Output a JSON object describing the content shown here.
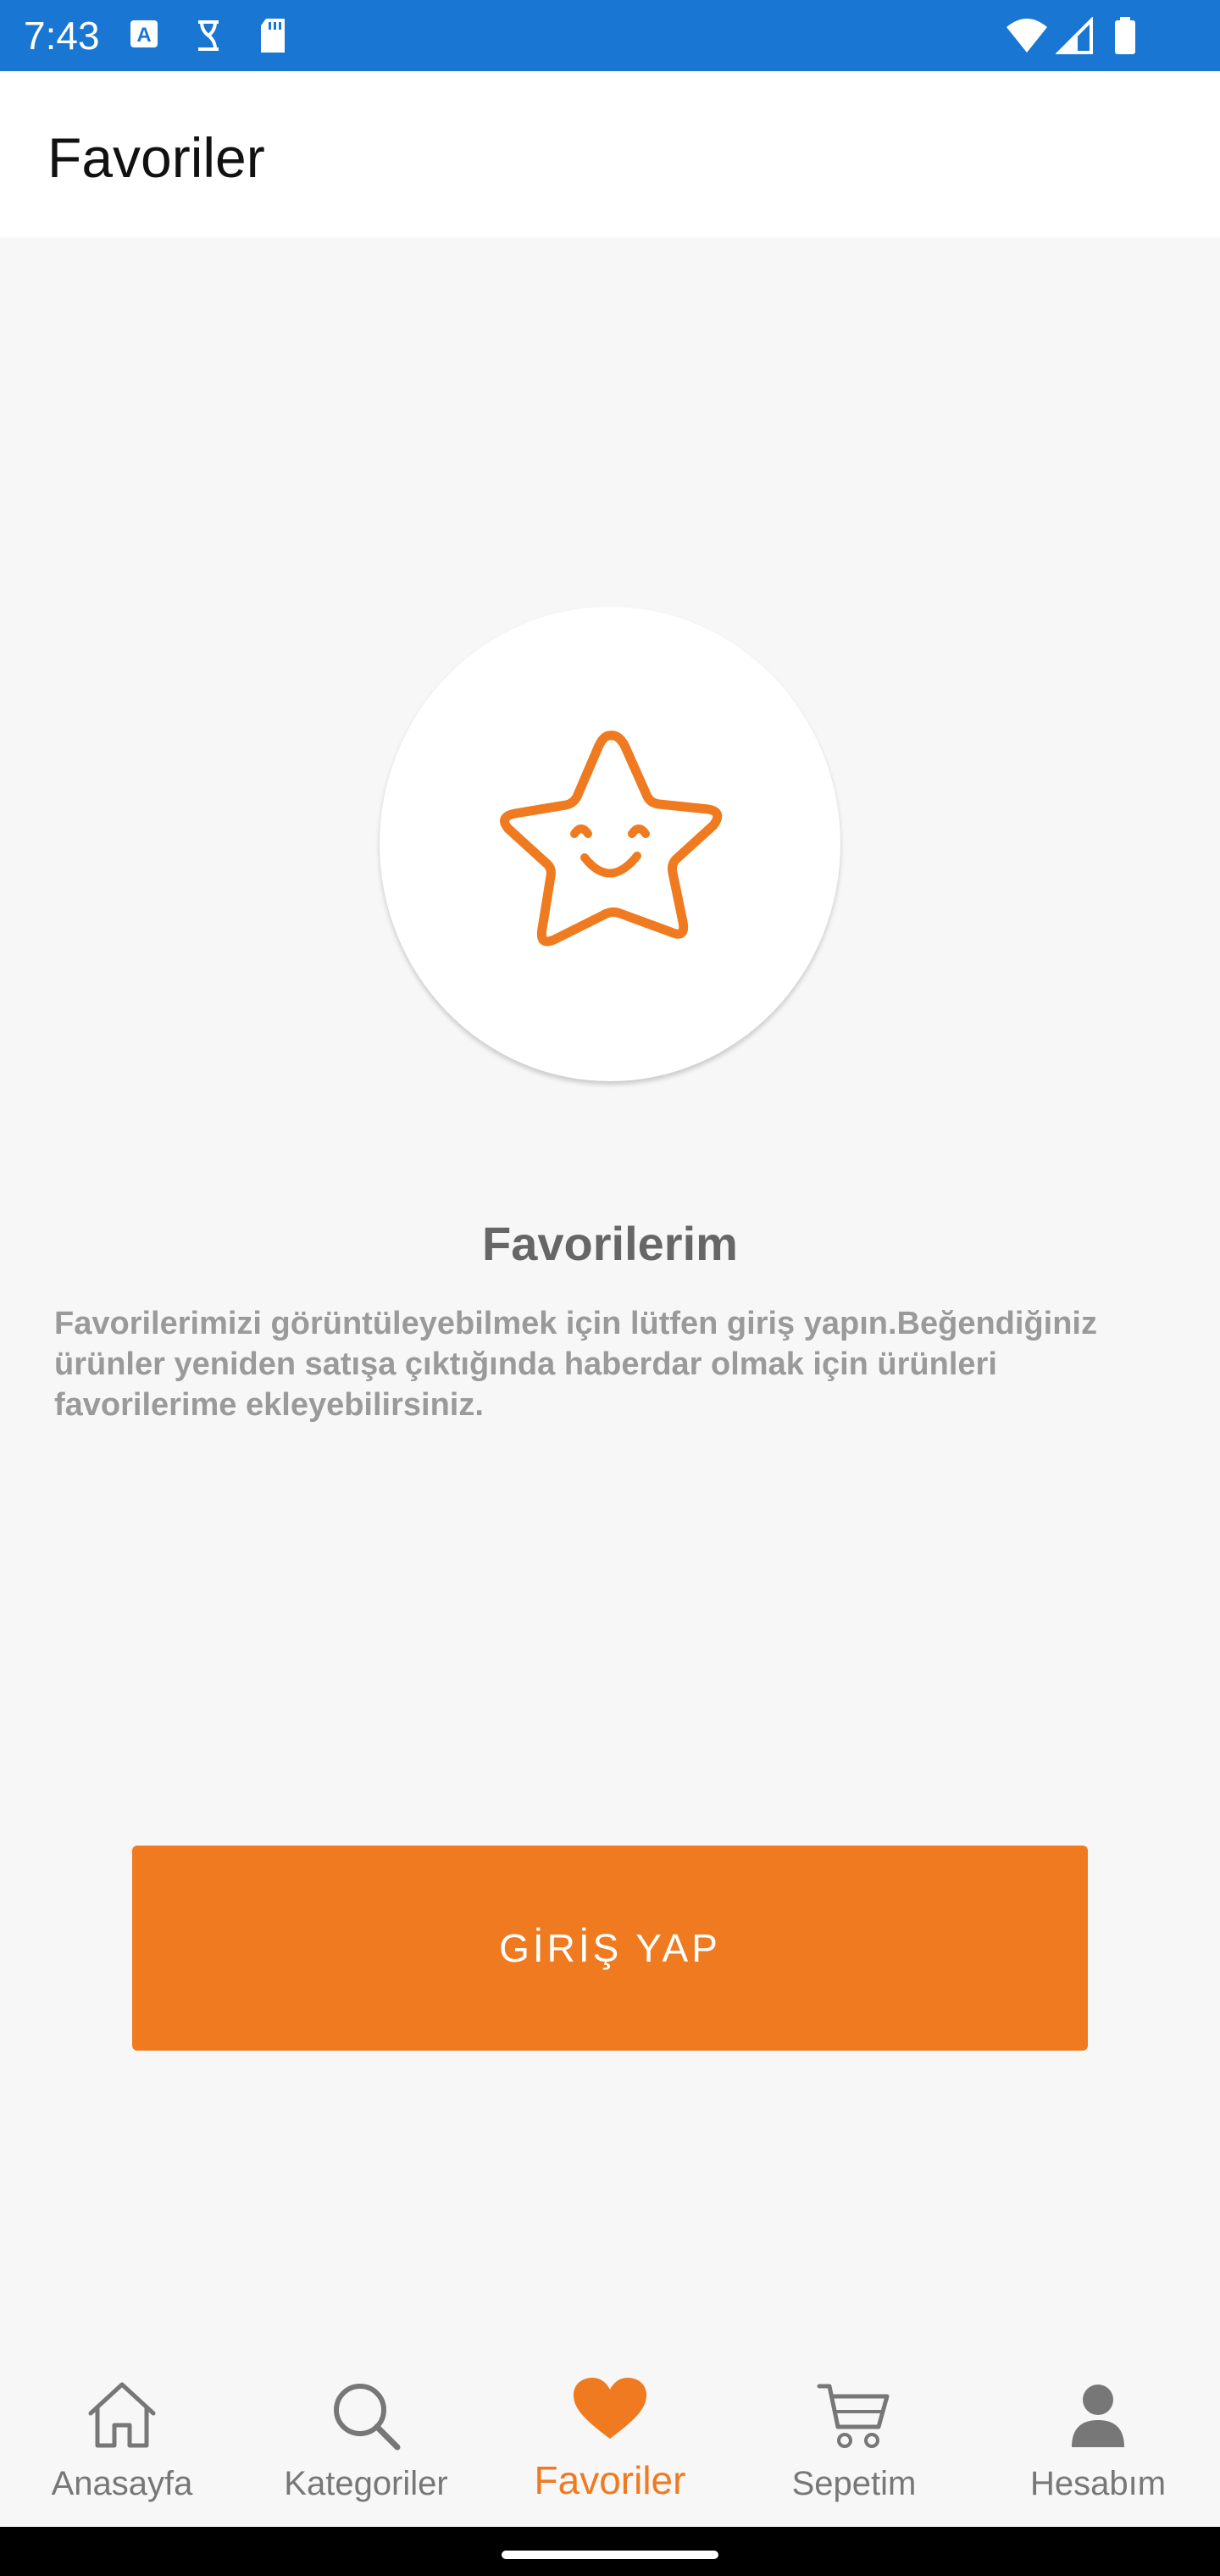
{
  "status_bar": {
    "time": "7:43"
  },
  "app_bar": {
    "title": "Favoriler"
  },
  "empty_state": {
    "title": "Favorilerim",
    "description": "Favorilerimizi görüntüleyebilmek için lütfen giriş yapın.Beğendiğiniz ürünler yeniden satışa çıktığında haberdar olmak için ürünleri favorilerime ekleyebilirsiniz.",
    "login_button": "GİRİŞ YAP"
  },
  "bottom_nav": {
    "items": [
      {
        "label": "Anasayfa",
        "icon": "home-icon",
        "active": false
      },
      {
        "label": "Kategoriler",
        "icon": "search-icon",
        "active": false
      },
      {
        "label": "Favoriler",
        "icon": "heart-icon",
        "active": true
      },
      {
        "label": "Sepetim",
        "icon": "cart-icon",
        "active": false
      },
      {
        "label": "Hesabım",
        "icon": "person-icon",
        "active": false
      }
    ]
  },
  "colors": {
    "status_bar": "#1976d2",
    "accent": "#f07a1f",
    "inactive": "#777777"
  }
}
